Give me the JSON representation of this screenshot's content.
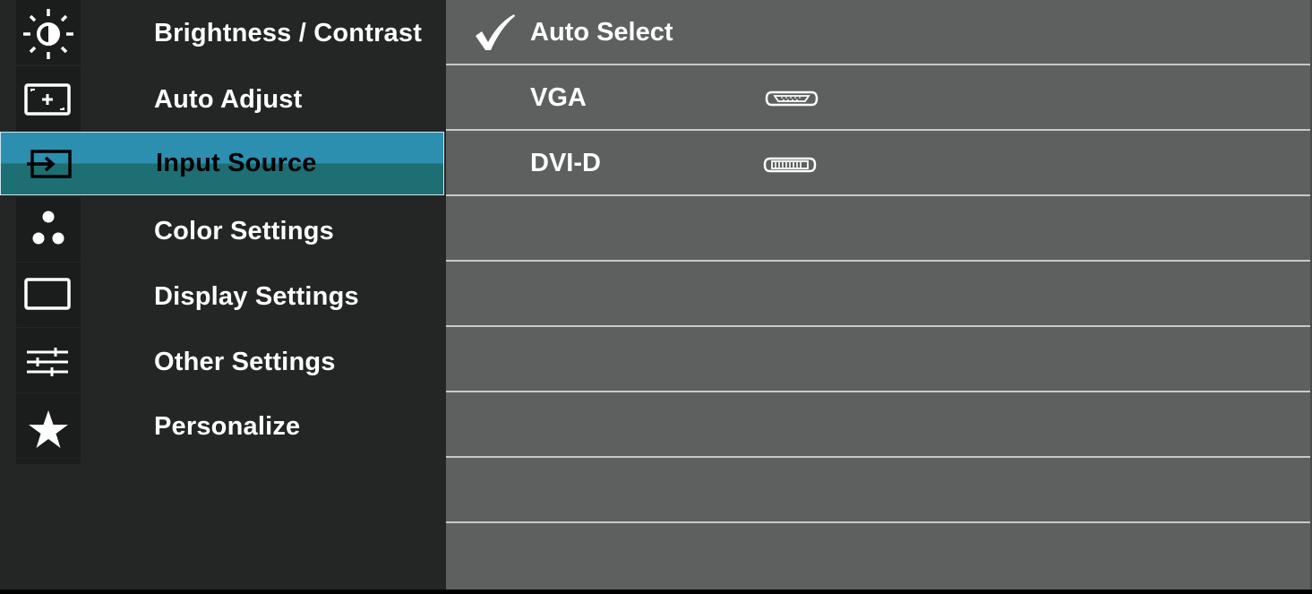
{
  "menu": {
    "items": [
      {
        "label": "Brightness / Contrast",
        "icon": "brightness-icon"
      },
      {
        "label": "Auto Adjust",
        "icon": "auto-adjust-icon"
      },
      {
        "label": "Input Source",
        "icon": "input-source-icon",
        "selected": true
      },
      {
        "label": "Color Settings",
        "icon": "color-settings-icon"
      },
      {
        "label": "Display Settings",
        "icon": "display-settings-icon"
      },
      {
        "label": "Other Settings",
        "icon": "other-settings-icon"
      },
      {
        "label": "Personalize",
        "icon": "star-icon"
      }
    ]
  },
  "submenu": {
    "options": [
      {
        "label": "Auto Select",
        "checked": true,
        "connector": ""
      },
      {
        "label": "VGA",
        "checked": false,
        "connector": "vga-connector-icon"
      },
      {
        "label": "DVI-D",
        "checked": false,
        "connector": "dvi-connector-icon"
      }
    ]
  },
  "colors": {
    "menu_background": "#242626",
    "panel_background": "#5e5f5f",
    "selection_top": "#2c8fb0",
    "selection_bottom": "#1d6f74",
    "divider": "#c9cbcb"
  }
}
